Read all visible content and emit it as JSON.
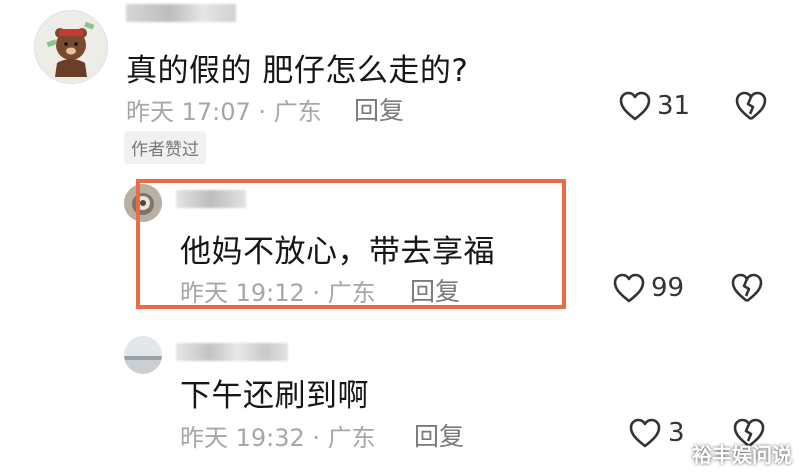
{
  "comments": [
    {
      "text": "真的假的 肥仔怎么走的?",
      "time": "昨天 17:07",
      "location": "广东",
      "reply_label": "回复",
      "likes": "31",
      "badge": "作者赞过"
    },
    {
      "text": "他妈不放心，带去享福",
      "time": "昨天 19:12",
      "location": "广东",
      "reply_label": "回复",
      "likes": "99"
    },
    {
      "text": "下午还刷到啊",
      "time": "昨天 19:32",
      "location": "广东",
      "reply_label": "回复",
      "likes": "3"
    }
  ],
  "colors": {
    "highlight_border": "#ec6b46",
    "meta_text": "#a6a6a6"
  },
  "icons": [
    "avatar",
    "heart-icon",
    "broken-heart-icon"
  ],
  "watermark": "裕丰娱问说"
}
